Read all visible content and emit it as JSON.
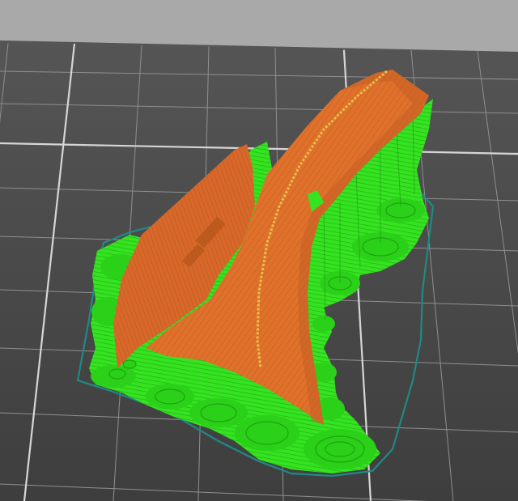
{
  "view": {
    "kind": "slicer-3d-preview",
    "background_color": "#a9a9a9",
    "bed_color": "#4a4a4a",
    "grid_color": "#8f8f8f",
    "grid_major_color": "#d4d4d4"
  },
  "scene": {
    "model_color": "#e0712b",
    "model_shadow_color": "#b5561b",
    "seam_color": "#e8c04a",
    "support_color": "#33e01f",
    "support_shadow_color": "#1fa813",
    "skirt_color": "#1f7d7a"
  }
}
